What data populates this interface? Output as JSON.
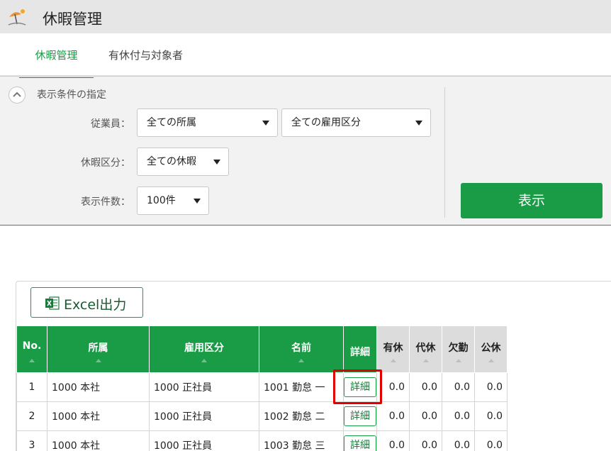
{
  "app": {
    "title": "休暇管理"
  },
  "tabs": [
    {
      "label": "休暇管理",
      "active": true
    },
    {
      "label": "有休付与対象者",
      "active": false
    }
  ],
  "filter": {
    "title": "表示条件の指定",
    "employee_label": "従業員：",
    "department_value": "全ての所属",
    "employment_type_value": "全ての雇用区分",
    "leave_type_label": "休暇区分：",
    "leave_type_value": "全ての休暇",
    "count_label": "表示件数：",
    "count_value": "100件",
    "display_button": "表示"
  },
  "results": {
    "excel_button": "Excel出力",
    "columns": [
      "No.",
      "所属",
      "雇用区分",
      "名前",
      "詳細",
      "有休",
      "代休",
      "欠勤",
      "公休"
    ],
    "detail_label": "詳細",
    "rows": [
      {
        "no": "1",
        "department": "1000 本社",
        "type": "1000 正社員",
        "name": "1001 勤怠 一",
        "v1": "0.0",
        "v2": "0.0",
        "v3": "0.0",
        "v4": "0.0"
      },
      {
        "no": "2",
        "department": "1000 本社",
        "type": "1000 正社員",
        "name": "1002 勤怠 二",
        "v1": "0.0",
        "v2": "0.0",
        "v3": "0.0",
        "v4": "0.0"
      },
      {
        "no": "3",
        "department": "1000 本社",
        "type": "1000 正社員",
        "name": "1003 勤怠 三",
        "v1": "0.0",
        "v2": "0.0",
        "v3": "0.0",
        "v4": "0.0"
      }
    ]
  },
  "colors": {
    "accent": "#1a9b46",
    "highlight": "#e00000"
  },
  "icons": {
    "app": "beach-umbrella-icon",
    "collapse": "chevron-up-icon",
    "excel": "excel-icon",
    "dropdown": "caret-down-icon"
  }
}
